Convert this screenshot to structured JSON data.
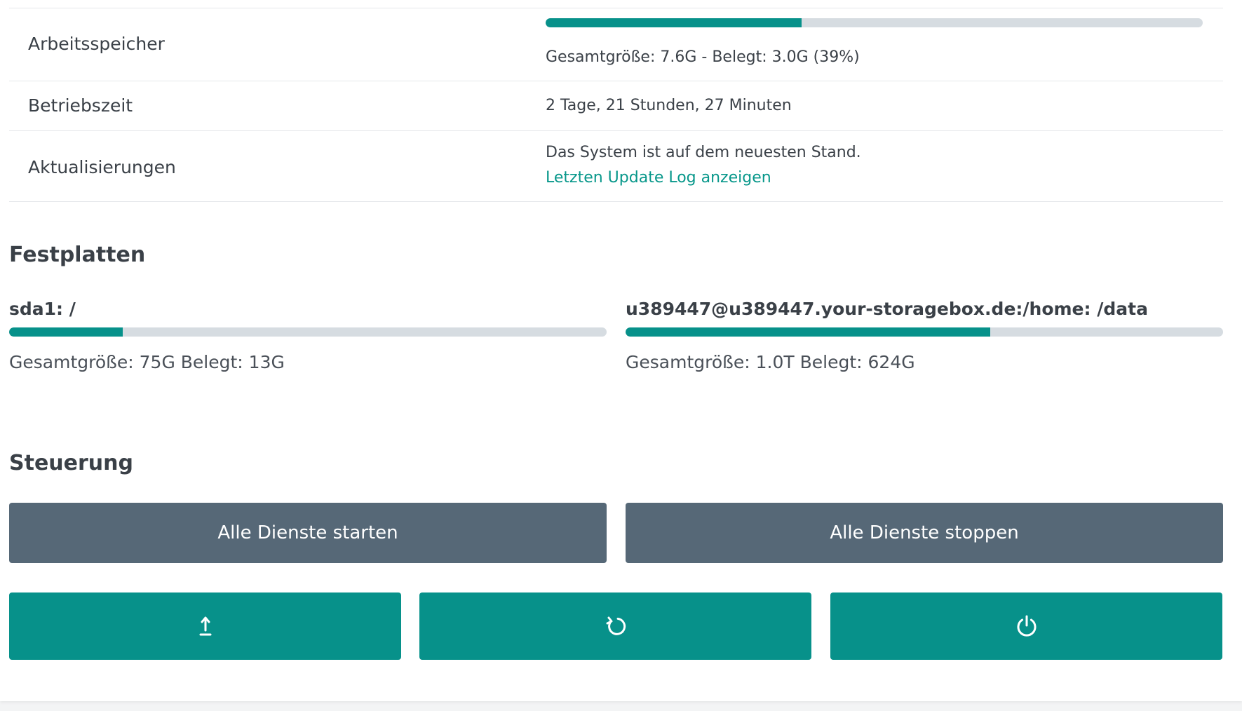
{
  "system_info": {
    "memory": {
      "label": "Arbeitsspeicher",
      "usage_percent": 39,
      "text": "Gesamtgröße: 7.6G - Belegt: 3.0G (39%)"
    },
    "uptime": {
      "label": "Betriebszeit",
      "value": "2 Tage, 21 Stunden, 27 Minuten"
    },
    "updates": {
      "label": "Aktualisierungen",
      "status": "Das System ist auf dem neuesten Stand.",
      "link_label": "Letzten Update Log anzeigen"
    }
  },
  "disks": {
    "title": "Festplatten",
    "items": [
      {
        "name": "sda1: /",
        "usage_fraction": 0.19,
        "info": "Gesamtgröße: 75G Belegt: 13G"
      },
      {
        "name": "u389447@u389447.your-storagebox.de:/home: /data",
        "usage_fraction": 0.61,
        "info": "Gesamtgröße: 1.0T Belegt: 624G"
      }
    ]
  },
  "controls": {
    "title": "Steuerung",
    "start_all_label": "Alle Dienste starten",
    "stop_all_label": "Alle Dienste stoppen",
    "icon_buttons": [
      {
        "icon": "upload-icon"
      },
      {
        "icon": "restart-icon"
      },
      {
        "icon": "power-icon"
      }
    ]
  },
  "colors": {
    "accent": "#07918a",
    "link": "#07978a",
    "button_gray": "#566877",
    "bar_track": "#d6dce1"
  }
}
